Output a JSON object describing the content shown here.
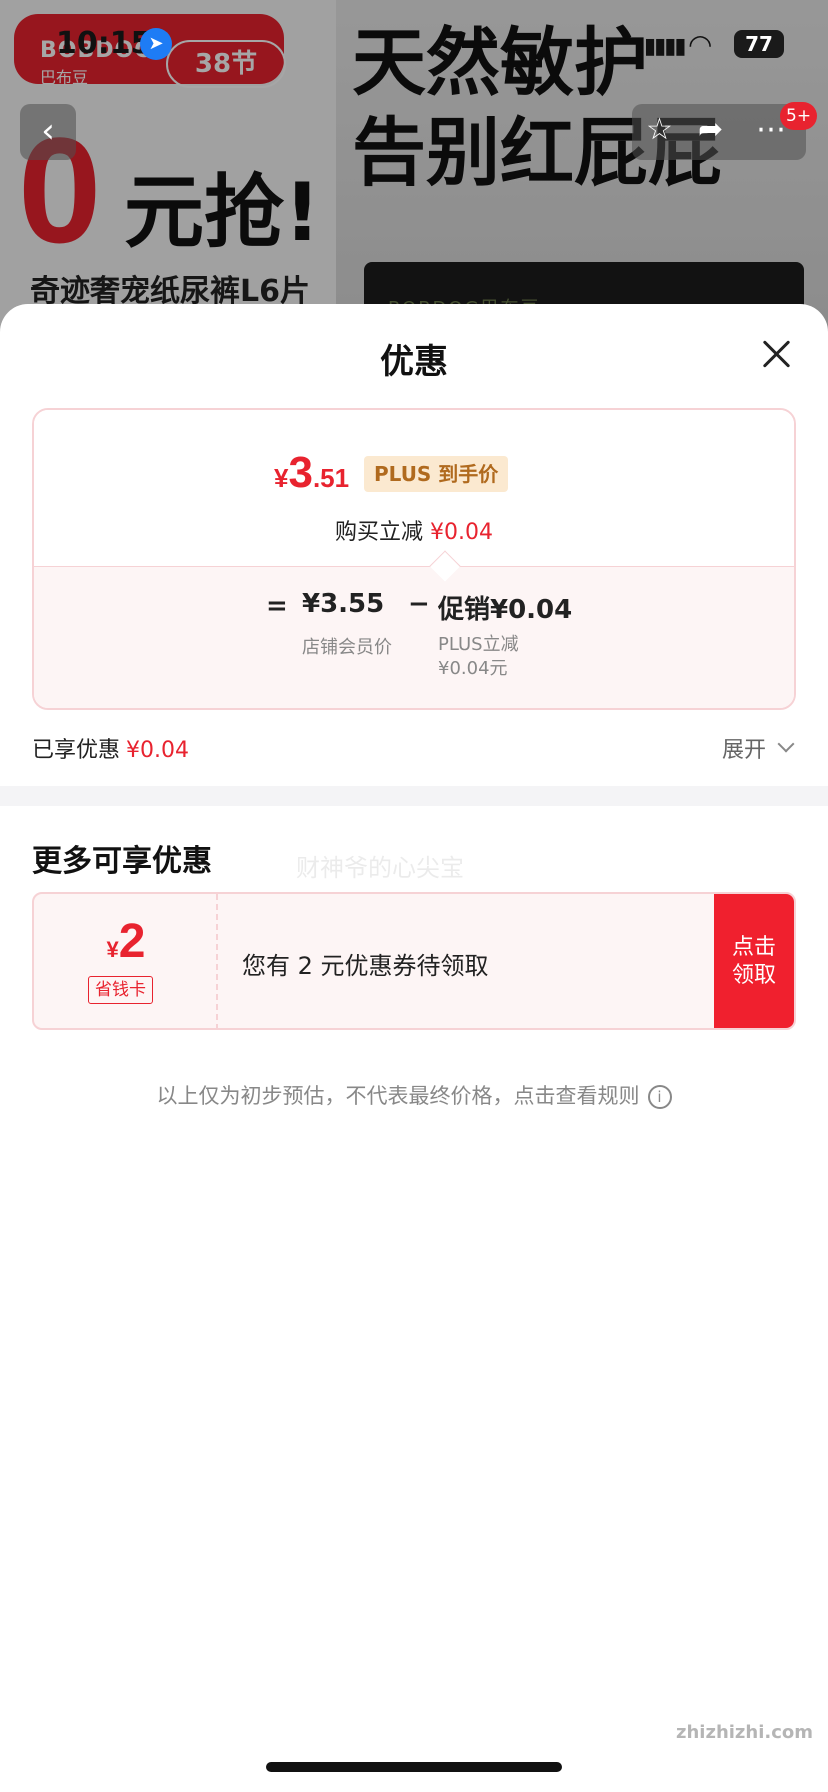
{
  "status_bar": {
    "time": "10:15",
    "battery": "77"
  },
  "background": {
    "brand": "BOBDOG",
    "brand_sub": "巴布豆",
    "festival": "38节",
    "promo_zero": "0",
    "promo_grab": "元抢!",
    "promo_sub": "奇迹奢宠纸尿裤L6片",
    "headline_line1": "天然敏护",
    "headline_line2": "告别红屁屁",
    "package_text": "BOBDOG巴布豆",
    "cart_badge": "5+"
  },
  "sheet": {
    "title": "优惠",
    "price": {
      "currency": "¥",
      "integer": "3",
      "decimal": ".51",
      "tag": "PLUS 到手价",
      "instant_label": "购买立减",
      "instant_value": "¥0.04"
    },
    "breakdown": {
      "equals": "=",
      "member_price": "¥3.55",
      "member_label": "店铺会员价",
      "minus": "−",
      "promo_value": "促销¥0.04",
      "plus_cut_line1": "PLUS立减",
      "plus_cut_line2": "¥0.04元"
    },
    "enjoyed_label": "已享优惠",
    "enjoyed_value": "¥0.04",
    "expand_label": "展开",
    "more_title": "更多可享优惠",
    "watermark": "财神爷的心尖宝",
    "coupon": {
      "currency": "¥",
      "amount": "2",
      "card_label": "省钱卡",
      "description": "您有 2 元优惠券待领取",
      "claim_line1": "点击",
      "claim_line2": "领取"
    },
    "disclaimer": "以上仅为初步预估，不代表最终价格，点击查看规则"
  },
  "site_mark": "zhizhizhi.com",
  "colors": {
    "accent_red": "#e8232f",
    "plus_gold": "#b06a1e",
    "plus_bg": "#fbe9d0"
  }
}
